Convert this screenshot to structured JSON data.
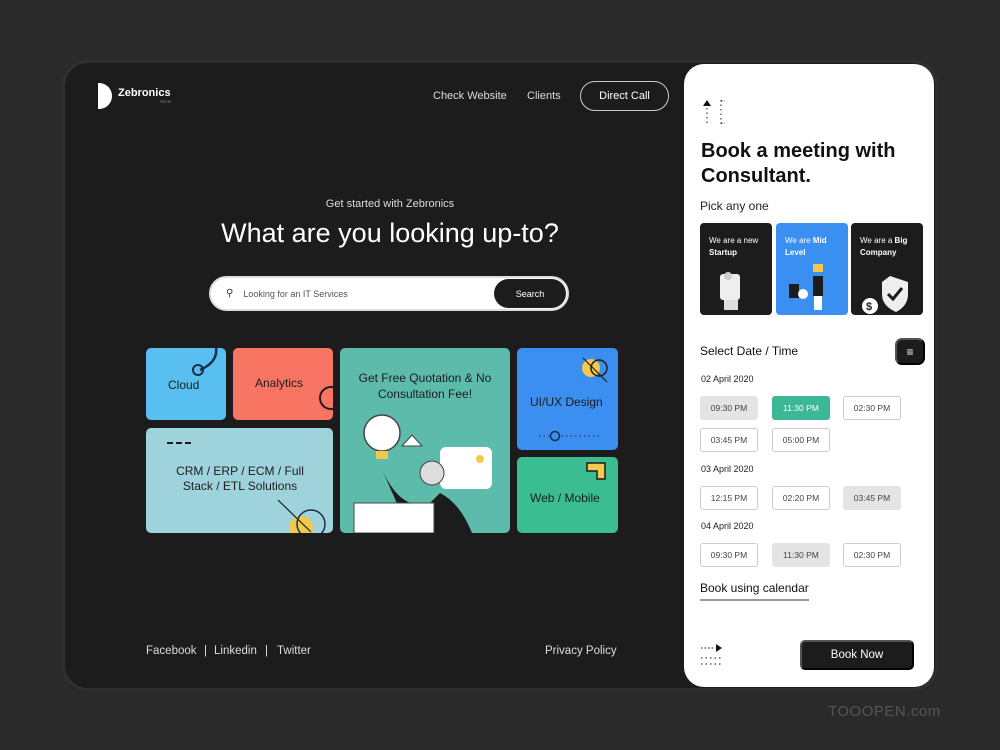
{
  "header": {
    "brand": "Zebronics",
    "brand_sub": "TECH",
    "nav": [
      "Check Website",
      "Clients"
    ],
    "direct_call": "Direct Call"
  },
  "hero": {
    "kicker": "Get started with Zebronics",
    "title": "What are you looking up-to?",
    "search_placeholder": "Looking for an IT Services",
    "search_button": "Search"
  },
  "tiles": {
    "cloud": "Cloud",
    "analytics": "Analytics",
    "crm": "CRM / ERP / ECM / Full Stack / ETL Solutions",
    "quote": "Get Free Quotation & No Consultation Fee!",
    "uiux": "UI/UX Design",
    "web": "Web / Mobile"
  },
  "colors": {
    "cloud": "#58bff0",
    "analytics": "#f87563",
    "crm": "#9fd3dc",
    "quote": "#5dbbac",
    "uiux": "#3b8ff0",
    "web": "#3bbd92",
    "selected_slot": "#3cb896"
  },
  "footer": {
    "links": [
      "Facebook",
      "Linkedin",
      "Twitter"
    ],
    "separator": "|",
    "privacy": "Privacy Policy"
  },
  "booking": {
    "title": "Book a meeting with Consultant.",
    "pick": "Pick any one",
    "cards": [
      {
        "pre": "We are a new",
        "bold": "Startup"
      },
      {
        "pre": "We are",
        "bold": "Mid Level"
      },
      {
        "pre": "We are a",
        "bold": "Big Company"
      }
    ],
    "select_label": "Select Date / Time",
    "days": [
      {
        "date": "02 April 2020",
        "slots": [
          {
            "t": "09:30 PM",
            "s": "busy"
          },
          {
            "t": "11:30 PM",
            "s": "selected"
          },
          {
            "t": "02:30 PM",
            "s": "open"
          },
          {
            "t": "03:45 PM",
            "s": "open"
          },
          {
            "t": "05:00 PM",
            "s": "open"
          }
        ]
      },
      {
        "date": "03 April 2020",
        "slots": [
          {
            "t": "12:15 PM",
            "s": "open"
          },
          {
            "t": "02:20 PM",
            "s": "open"
          },
          {
            "t": "03:45 PM",
            "s": "busy"
          }
        ]
      },
      {
        "date": "04 April 2020",
        "slots": [
          {
            "t": "09:30 PM",
            "s": "open"
          },
          {
            "t": "11:30 PM",
            "s": "busy"
          },
          {
            "t": "02:30 PM",
            "s": "open"
          }
        ]
      }
    ],
    "calendar_link": "Book using calendar",
    "book_now": "Book Now"
  },
  "watermark": "TOOOPEN.com"
}
